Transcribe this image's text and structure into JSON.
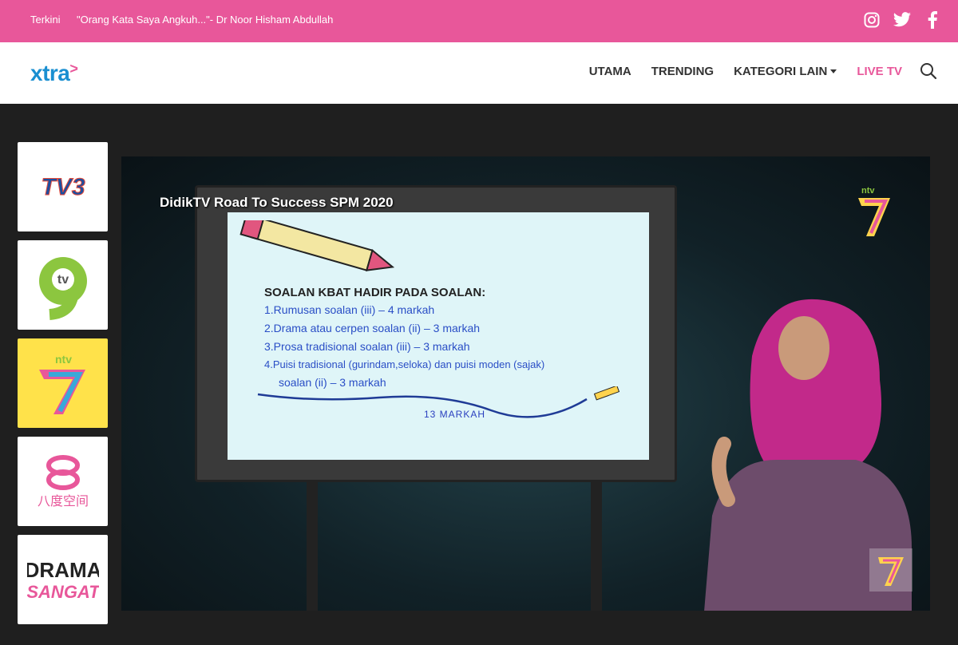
{
  "topbar": {
    "terkini_label": "Terkini",
    "headline": "\"Orang Kata Saya Angkuh...\"- Dr Noor Hisham Abdullah",
    "social": [
      "instagram-icon",
      "twitter-icon",
      "facebook-icon"
    ],
    "bg_color": "#e8579a"
  },
  "header": {
    "logo_text": "xtra",
    "nav": {
      "utama": "UTAMA",
      "trending": "TRENDING",
      "kategori": "KATEGORI LAIN",
      "live": "LIVE TV"
    },
    "accent_color": "#e8579a"
  },
  "channels": [
    {
      "name": "TV3",
      "label": "TV3"
    },
    {
      "name": "TV9",
      "label": "tv9"
    },
    {
      "name": "NTV7",
      "label": "ntv7",
      "active": true
    },
    {
      "name": "8TV",
      "label": "八度空间"
    },
    {
      "name": "Drama Sangat",
      "label": "DRAMA SANGAT"
    }
  ],
  "player": {
    "overlay_title": "DidikTV Road To Success SPM 2020",
    "screen": {
      "heading": "SOALAN KBAT HADIR PADA SOALAN:",
      "lines": [
        "1.Rumusan soalan (iii) – 4 markah",
        "2.Drama atau cerpen soalan (ii) – 3 markah",
        "3.Prosa tradisional soalan (iii) – 3 markah",
        "4.Puisi tradisional (gurindam,seloka) dan puisi moden (sajak)",
        "soalan (ii) – 3 markah"
      ],
      "total": "13 MARKAH"
    },
    "channel_badge": "ntv7"
  }
}
